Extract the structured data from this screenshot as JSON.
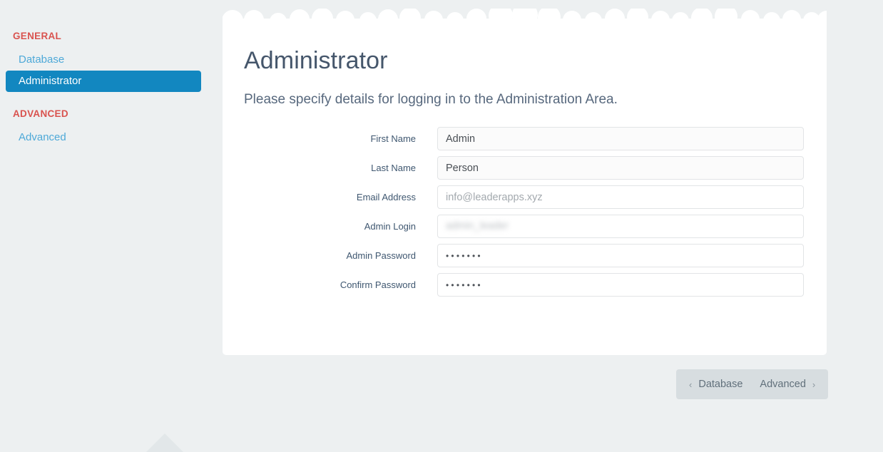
{
  "theme": {
    "page_bg": "#edf0f1",
    "card_bg": "#ffffff",
    "accent_blue": "#1287c0",
    "link_blue": "#4ea9d8",
    "group_red": "#d9534f",
    "heading_color": "#45566b",
    "footer_nav_bg": "#d7dde0"
  },
  "sidebar": {
    "groups": [
      {
        "title": "GENERAL",
        "items": [
          {
            "label": "Database",
            "active": false
          },
          {
            "label": "Administrator",
            "active": true
          }
        ]
      },
      {
        "title": "ADVANCED",
        "items": [
          {
            "label": "Advanced",
            "active": false
          }
        ]
      }
    ]
  },
  "main": {
    "title": "Administrator",
    "subtitle": "Please specify details for logging in to the Administration Area.",
    "fields": [
      {
        "label": "First Name",
        "value": "Admin",
        "placeholder": "",
        "type": "text",
        "name": "first-name"
      },
      {
        "label": "Last Name",
        "value": "Person",
        "placeholder": "",
        "type": "text",
        "name": "last-name"
      },
      {
        "label": "Email Address",
        "value": "",
        "placeholder": "info@leaderapps.xyz",
        "type": "email",
        "name": "email-address"
      },
      {
        "label": "Admin Login",
        "value": "admin_leader",
        "placeholder": "",
        "type": "redacted",
        "name": "admin-login"
      },
      {
        "label": "Admin Password",
        "value": "•••••••",
        "placeholder": "",
        "type": "password",
        "name": "admin-password"
      },
      {
        "label": "Confirm Password",
        "value": "•••••••",
        "placeholder": "",
        "type": "password",
        "name": "confirm-password"
      }
    ]
  },
  "footer": {
    "prev_chevron": "‹",
    "prev_label": "Database",
    "next_label": "Advanced",
    "next_chevron": "›"
  }
}
